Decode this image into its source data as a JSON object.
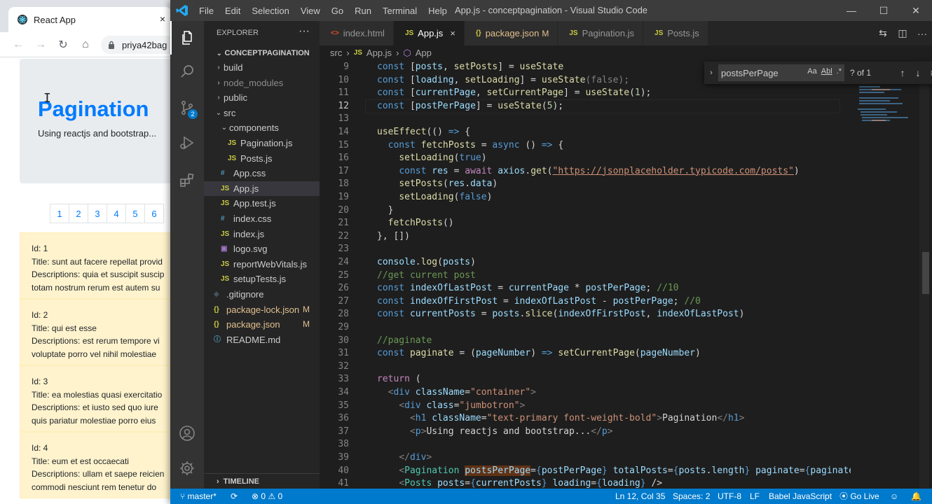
{
  "browser": {
    "tab_title": "React App",
    "tab_close": "×",
    "address": "priya42bag",
    "page": {
      "title": "Pagination",
      "subtitle": "Using reactjs and bootstrap...",
      "pages": [
        "1",
        "2",
        "3",
        "4",
        "5",
        "6"
      ],
      "posts": [
        {
          "id": "Id: 1",
          "title": "Title: sunt aut facere repellat provid",
          "desc1": "Descriptions: quia et suscipit suscip",
          "desc2": "totam nostrum rerum est autem su"
        },
        {
          "id": "Id: 2",
          "title": "Title: qui est esse",
          "desc1": "Descriptions: est rerum tempore vi",
          "desc2": "voluptate porro vel nihil molestiae"
        },
        {
          "id": "Id: 3",
          "title": "Title: ea molestias quasi exercitatio",
          "desc1": "Descriptions: et iusto sed quo iure",
          "desc2": "quis pariatur molestiae porro eius"
        },
        {
          "id": "Id: 4",
          "title": "Title: eum et est occaecati",
          "desc1": "Descriptions: ullam et saepe reicien",
          "desc2": "commodi nesciunt rem tenetur do"
        }
      ]
    }
  },
  "vscode": {
    "menu": [
      "File",
      "Edit",
      "Selection",
      "View",
      "Go",
      "Run",
      "Terminal",
      "Help"
    ],
    "window_title": "App.js - conceptpagination - Visual Studio Code",
    "window_controls": {
      "minimize": "—",
      "maximize": "☐",
      "close": "✕"
    },
    "explorer": {
      "header": "EXPLORER",
      "more": "···",
      "root": "CONCEPTPAGINATION",
      "timeline": "TIMELINE"
    },
    "tree": {
      "build": "build",
      "node_modules": "node_modules",
      "public": "public",
      "src": "src",
      "components": "components",
      "pagination": "Pagination.js",
      "posts": "Posts.js",
      "app_css": "App.css",
      "app_js": "App.js",
      "app_test": "App.test.js",
      "index_css": "index.css",
      "index_js": "index.js",
      "logo": "logo.svg",
      "report": "reportWebVitals.js",
      "setup": "setupTests.js",
      "gitignore": ".gitignore",
      "pkg_lock": "package-lock.json",
      "pkg": "package.json",
      "readme": "README.md",
      "modified_flag": "M",
      "js_icon": "JS",
      "css_icon": "#",
      "json_icon": "{}",
      "md_icon": "ⓘ"
    },
    "tabs": {
      "t1": "index.html",
      "t2": "App.js",
      "t3": "package.json",
      "t3_flag": "M",
      "t4": "Pagination.js",
      "t5": "Posts.js",
      "close": "×"
    },
    "breadcrumb": {
      "a": "src",
      "b": "App.js",
      "c": "App",
      "sep": "›"
    },
    "find": {
      "query": "postsPerPage",
      "count": "? of 1",
      "aa": "Aa",
      "ab": "Abl",
      "re": ".*"
    },
    "activity_badge": "2",
    "line_numbers": [
      "9",
      "10",
      "11",
      "12",
      "13",
      "14",
      "15",
      "16",
      "17",
      "18",
      "19",
      "20",
      "21",
      "22",
      "23",
      "24",
      "25",
      "26",
      "27",
      "28",
      "29",
      "30",
      "31",
      "32",
      "33",
      "34",
      "35",
      "36",
      "37",
      "38",
      "39",
      "40",
      "41"
    ],
    "status": {
      "branch": "master*",
      "sync": "⟳",
      "problems": "⊗ 0 ⚠ 0",
      "position": "Ln 12, Col 35",
      "spaces": "Spaces: 2",
      "encoding": "UTF-8",
      "eol": "LF",
      "language": "Babel JavaScript",
      "golive": "Go Live"
    },
    "colors": {
      "accent": "#007acc",
      "editor_bg": "#1e1e1e",
      "sidebar_bg": "#252526"
    }
  }
}
